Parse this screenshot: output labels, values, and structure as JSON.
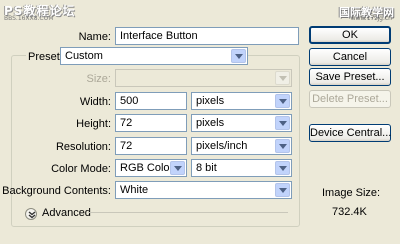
{
  "watermark": {
    "left": "PS教程论坛",
    "left_sub": "BBS.16XX8.COM",
    "right": "国际教学网",
    "right_sub": "www.17zjg.cn"
  },
  "form": {
    "name_label": "Name:",
    "name_value": "Interface Button",
    "preset_label": "Preset:",
    "preset_value": "Custom",
    "size_label": "Size:",
    "size_value": "",
    "width_label": "Width:",
    "width_value": "500",
    "width_unit": "pixels",
    "height_label": "Height:",
    "height_value": "72",
    "height_unit": "pixels",
    "resolution_label": "Resolution:",
    "resolution_value": "72",
    "resolution_unit": "pixels/inch",
    "color_mode_label": "Color Mode:",
    "color_mode_value": "RGB Color",
    "bit_depth_value": "8 bit",
    "background_label": "Background Contents:",
    "background_value": "White",
    "advanced_label": "Advanced"
  },
  "buttons": {
    "ok": "OK",
    "cancel": "Cancel",
    "save_preset": "Save Preset...",
    "delete_preset": "Delete Preset...",
    "device_central": "Device Central..."
  },
  "info": {
    "image_size_label": "Image Size:",
    "image_size_value": "732.4K"
  }
}
